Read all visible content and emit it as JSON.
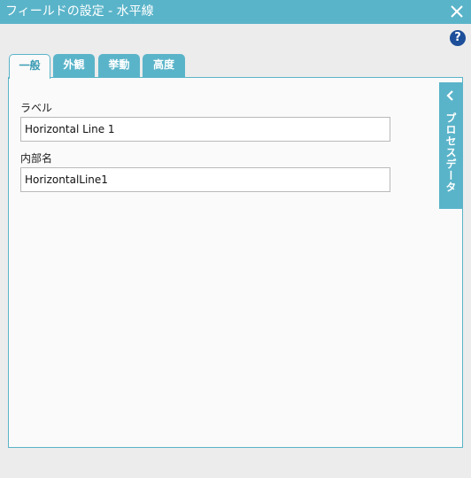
{
  "window": {
    "title": "フィールドの設定 - 水平線",
    "close_icon": "close-icon",
    "help_label": "?"
  },
  "tabs": [
    {
      "label": "一般",
      "active": true
    },
    {
      "label": "外観",
      "active": false
    },
    {
      "label": "挙動",
      "active": false
    },
    {
      "label": "高度",
      "active": false
    }
  ],
  "fields": {
    "label": {
      "caption": "ラベル",
      "value": "Horizontal Line 1"
    },
    "internal_name": {
      "caption": "内部名",
      "value": "HorizontalLine1"
    }
  },
  "side_panel": {
    "label": "プロセスデータ",
    "chevron_icon": "chevron-left-icon"
  },
  "colors": {
    "accent": "#5ab4c9",
    "help": "#1d4f9a",
    "panel_bg": "#fafafa"
  }
}
